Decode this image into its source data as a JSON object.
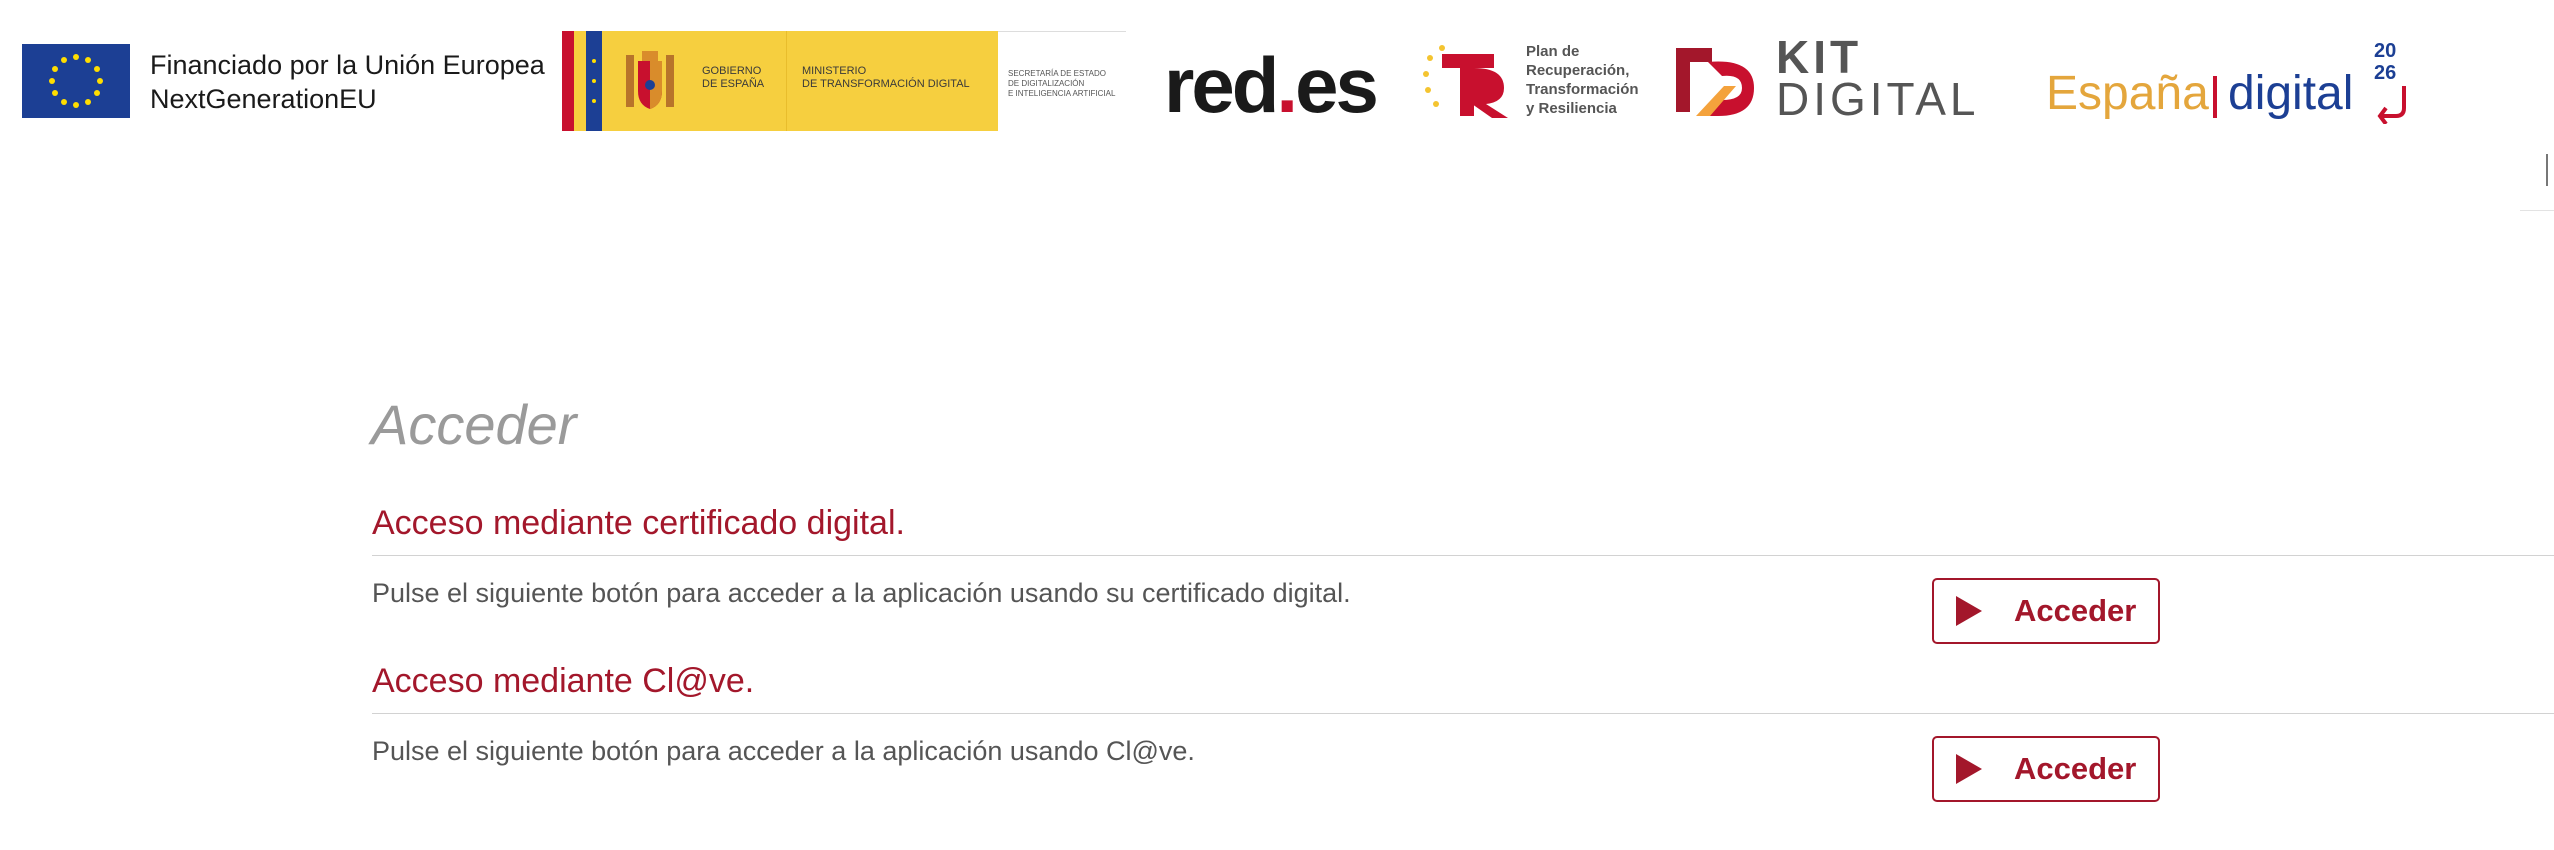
{
  "header": {
    "eu": {
      "line1": "Financiado por la Unión Europea",
      "line2": "NextGenerationEU"
    },
    "gobierno": {
      "col1": [
        "GOBIERNO",
        "DE ESPAÑA"
      ],
      "col2": [
        "MINISTERIO",
        "DE TRANSFORMACIÓN DIGITAL"
      ],
      "col3": [
        "SECRETARÍA DE ESTADO",
        "DE DIGITALIZACIÓN",
        "E INTELIGENCIA ARTIFICIAL"
      ]
    },
    "redes": {
      "part1": "red",
      "part2": ".",
      "part3": "es"
    },
    "prtr": [
      "Plan de",
      "Recuperación,",
      "Transformación",
      "y Resiliencia"
    ],
    "kit": {
      "line1": "KIT",
      "line2": "DIGITAL"
    },
    "espana": {
      "word1": "España",
      "word2": "digital",
      "year_top": "20",
      "year_bottom": "26"
    }
  },
  "main": {
    "title": "Acceder",
    "sections": [
      {
        "heading": "Acceso mediante certificado digital.",
        "text": "Pulse el siguiente botón para acceder a la aplicación usando su certificado digital.",
        "button_label": "Acceder"
      },
      {
        "heading": "Acceso mediante Cl@ve.",
        "text": "Pulse el siguiente botón para acceder a la aplicación usando Cl@ve.",
        "button_label": "Acceder"
      }
    ]
  },
  "colors": {
    "accent": "#a3172b",
    "title_gray": "#9a9a9a",
    "text_gray": "#555555",
    "eu_blue": "#1c3f94",
    "gob_yellow": "#f6cf3f"
  },
  "icons": {
    "button_icon": "play-triangle-icon"
  }
}
